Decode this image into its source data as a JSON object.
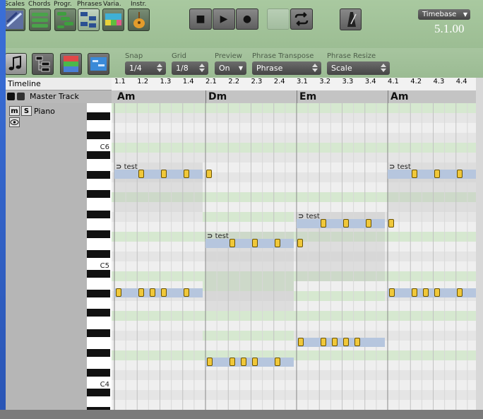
{
  "toolbar": {
    "tabs": [
      "Scales",
      "Chords",
      "Progr.",
      "Phrases",
      "Varia.",
      "Instr."
    ],
    "active_tab": "Phrases",
    "transport": {
      "stop": "■",
      "play": "▶",
      "record": "●"
    },
    "timebase": {
      "label": "Timebase",
      "value": "5.1.00"
    }
  },
  "controls": {
    "snap": {
      "label": "Snap",
      "value": "1/4"
    },
    "grid": {
      "label": "Grid",
      "value": "1/8"
    },
    "preview": {
      "label": "Preview",
      "value": "On"
    },
    "phrase_transpose": {
      "label": "Phrase Transpose",
      "value": "Phrase"
    },
    "phrase_resize": {
      "label": "Phrase Resize",
      "value": "Scale"
    }
  },
  "tracks": {
    "timeline_label": "Timeline",
    "master_label": "Master Track",
    "track_name": "Piano",
    "mute": "m",
    "solo": "S"
  },
  "keyboard": {
    "octave_labels": [
      "C6",
      "C5",
      "C4"
    ]
  },
  "ruler": {
    "beats": [
      "1.1",
      "1.2",
      "1.3",
      "1.4",
      "2.1",
      "2.2",
      "2.3",
      "2.4",
      "3.1",
      "3.2",
      "3.3",
      "3.4",
      "4.1",
      "4.2",
      "4.3",
      "4.4"
    ]
  },
  "chords": [
    "Am",
    "Dm",
    "Em",
    "Am"
  ],
  "phrases": [
    {
      "bar": 1,
      "label": "test"
    },
    {
      "bar": 2,
      "label": "test"
    },
    {
      "bar": 3,
      "label": "test"
    },
    {
      "bar": 4,
      "label": "test"
    }
  ],
  "colors": {
    "toolbar_bg": "#a9c9a0",
    "note_fill": "#f0c83a",
    "grid_bg": "#f3f3f3",
    "phrase_band": "#b6c6de",
    "chord_row": "#d8e8d2"
  }
}
